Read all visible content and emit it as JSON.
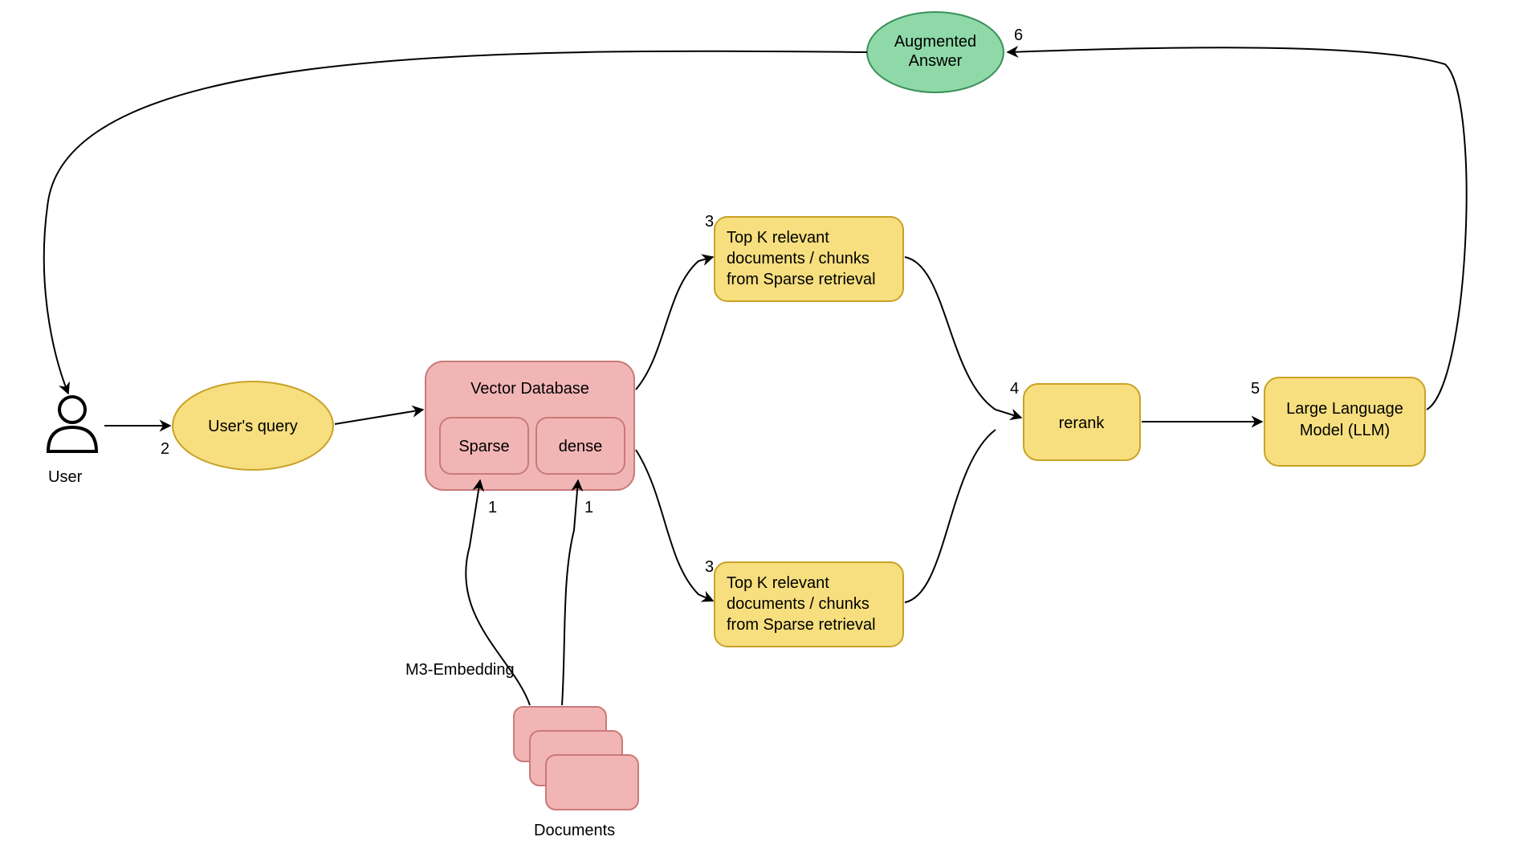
{
  "user": {
    "label": "User"
  },
  "user_query": {
    "label": "User's query"
  },
  "vector_db": {
    "title": "Vector Database",
    "sparse": "Sparse",
    "dense": "dense"
  },
  "docs": {
    "label": "Documents"
  },
  "embedding": {
    "label": "M3-Embedding"
  },
  "topk_sparse": {
    "text": "Top K relevant documents / chunks from Sparse retrieval"
  },
  "topk_dense": {
    "text": "Top K relevant documents / chunks from Sparse retrieval"
  },
  "rerank": {
    "label": "rerank"
  },
  "llm": {
    "label": "Large Language Model (LLM)"
  },
  "augmented": {
    "label": "Augmented Answer"
  },
  "steps": {
    "s1a": "1",
    "s1b": "1",
    "s2": "2",
    "s3a": "3",
    "s3b": "3",
    "s4": "4",
    "s5": "5",
    "s6": "6"
  },
  "colors": {
    "yellow_fill": "#f7df7f",
    "yellow_stroke": "#c9a227",
    "pink_fill": "#f2b5b5",
    "pink_stroke": "#c97a7a",
    "green_fill": "#8fd9a8",
    "green_stroke": "#3a915a",
    "ink": "#000000"
  }
}
